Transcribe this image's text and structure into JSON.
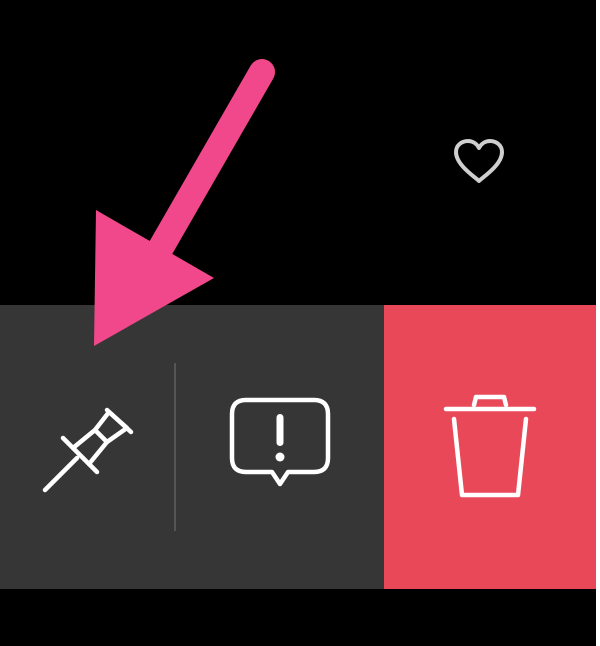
{
  "icons": {
    "heart": "heart-icon",
    "pin": "pushpin-icon",
    "report": "report-icon",
    "delete": "trash-icon",
    "annotation": "arrow-annotation"
  },
  "colors": {
    "background": "#000000",
    "action_bg": "#363636",
    "delete_bg": "#e84857",
    "icon": "#ffffff",
    "heart_icon": "#cfcfcf",
    "divider": "#555555",
    "annotation": "#f0488a"
  }
}
